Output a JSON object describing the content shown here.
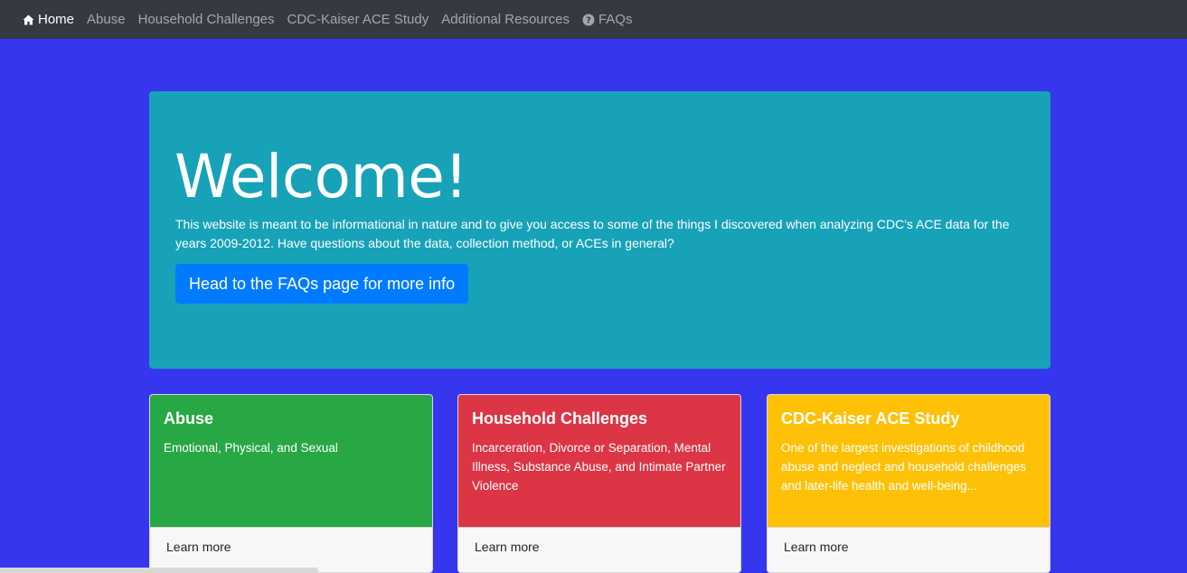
{
  "nav": {
    "items": [
      {
        "label": "Home",
        "icon": "home-icon",
        "active": true
      },
      {
        "label": "Abuse"
      },
      {
        "label": "Household Challenges"
      },
      {
        "label": "CDC-Kaiser ACE Study"
      },
      {
        "label": "Additional Resources"
      },
      {
        "label": "FAQs",
        "icon": "question-circle-icon"
      }
    ]
  },
  "jumbotron": {
    "title": "Welcome!",
    "text": "This website is meant to be informational in nature and to give you access to some of the things I discovered when analyzing CDC's ACE data for the years 2009-2012. Have questions about the data, collection method, or ACEs in general?",
    "button_label": "Head to the FAQs page for more info"
  },
  "cards": [
    {
      "title": "Abuse",
      "text": "Emotional, Physical, and Sexual",
      "footer": "Learn more",
      "color": "#28a745"
    },
    {
      "title": "Household Challenges",
      "text": "Incarceration, Divorce or Separation, Mental Illness, Substance Abuse, and Intimate Partner Violence",
      "footer": "Learn more",
      "color": "#dc3545"
    },
    {
      "title": "CDC-Kaiser ACE Study",
      "text": "One of the largest investigations of childhood abuse and neglect and household challenges and later-life health and well-being...",
      "footer": "Learn more",
      "color": "#ffc107"
    }
  ],
  "colors": {
    "page_background": "#3636ef",
    "navbar": "#343a40",
    "jumbotron": "#17a2b8",
    "primary_button": "#007bff"
  }
}
